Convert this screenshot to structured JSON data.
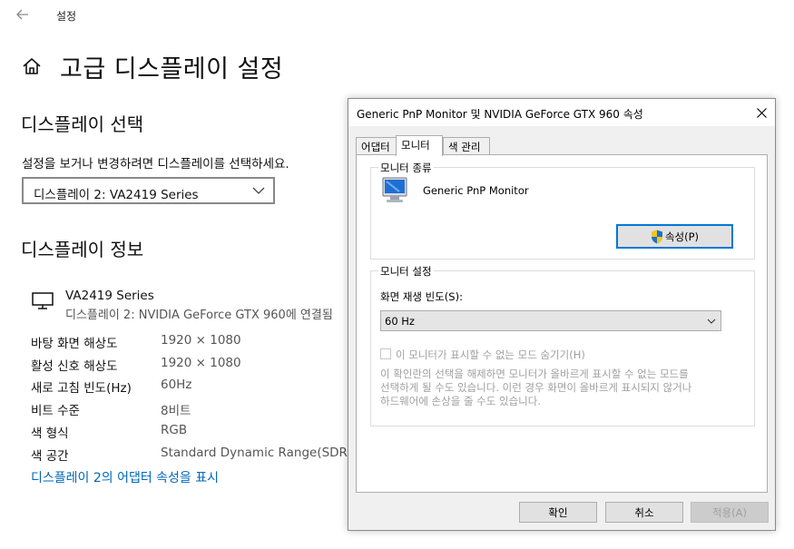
{
  "topbar": {
    "title": "설정"
  },
  "page_title": "고급 디스플레이 설정",
  "select_display": {
    "title": "디스플레이 선택",
    "description": "설정을 보거나 변경하려면 디스플레이를 선택하세요.",
    "selected": "디스플레이 2: VA2419 Series"
  },
  "display_info": {
    "title": "디스플레이 정보",
    "monitor_name": "VA2419 Series",
    "monitor_connection": "디스플레이 2: NVIDIA GeForce GTX 960에 연결됨",
    "rows": [
      {
        "label": "바탕 화면 해상도",
        "value": "1920 × 1080"
      },
      {
        "label": "활성 신호 해상도",
        "value": "1920 × 1080"
      },
      {
        "label": "새로 고침 빈도(Hz)",
        "value": "60Hz"
      },
      {
        "label": "비트 수준",
        "value": "8비트"
      },
      {
        "label": "색 형식",
        "value": "RGB"
      },
      {
        "label": "색 공간",
        "value": "Standard Dynamic Range(SDR)"
      }
    ],
    "adapter_link": "디스플레이 2의 어댑터 속성을 표시"
  },
  "dialog": {
    "title": "Generic PnP Monitor 및 NVIDIA GeForce GTX 960 속성",
    "tabs": [
      "어댑터",
      "모니터",
      "색 관리"
    ],
    "active_tab": "모니터",
    "monitor_type": {
      "group_label": "모니터 종류",
      "name": "Generic PnP Monitor",
      "properties_button": "속성(P)"
    },
    "monitor_settings": {
      "group_label": "모니터 설정",
      "refresh_label": "화면 재생 빈도(S):",
      "refresh_value": "60 Hz",
      "hide_modes_label": "이 모니터가 표시할 수 없는 모드 숨기기(H)",
      "hide_modes_checked": false,
      "warning_lines": [
        "이 확인란의 선택을 해제하면 모니터가 올바르게 표시할 수 없는 모드를",
        "선택하게 될 수도 있습니다. 이런 경우 화면이 올바르게 표시되지 않거나",
        "하드웨어에 손상을 줄 수도 있습니다."
      ]
    },
    "buttons": {
      "ok": "확인",
      "cancel": "취소",
      "apply": "적용(A)"
    }
  },
  "colors": {
    "link": "#0067b8",
    "focus": "#0078d7",
    "dialog_bg": "#f0f0f0"
  }
}
